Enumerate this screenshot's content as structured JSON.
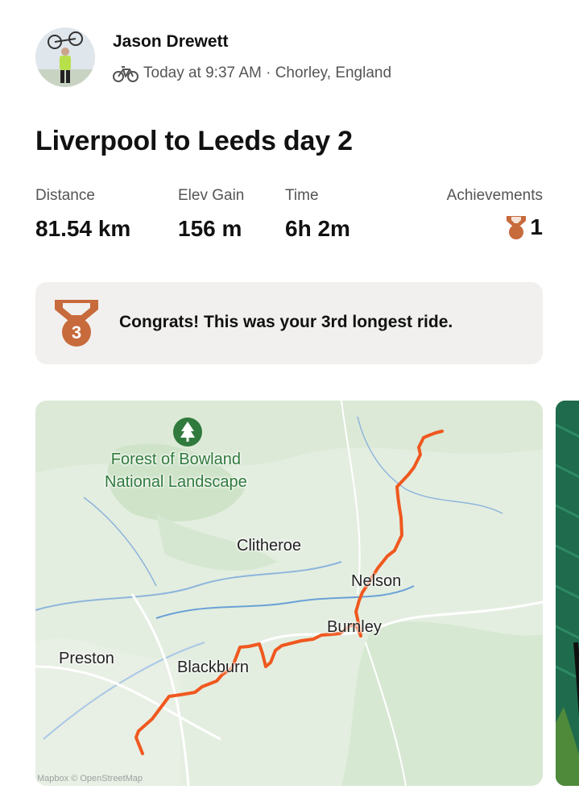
{
  "athlete": {
    "name": "Jason Drewett",
    "meta": "Today at 9:37 AM · Chorley, England",
    "activity_icon": "bike-icon"
  },
  "activity": {
    "title": "Liverpool to Leeds day 2"
  },
  "stats": {
    "distance": {
      "label": "Distance",
      "value": "81.54 km"
    },
    "elev_gain": {
      "label": "Elev Gain",
      "value": "156 m"
    },
    "time": {
      "label": "Time",
      "value": "6h 2m"
    },
    "achievements": {
      "label": "Achievements",
      "value": "1",
      "icon": "medal-icon"
    }
  },
  "banner": {
    "rank": "3",
    "text": "Congrats! This was your 3rd longest ride.",
    "icon": "bronze-medal-icon"
  },
  "map": {
    "labels": {
      "park": "Forest of Bowland\nNational Landscape",
      "park_line1": "Forest of Bowland",
      "park_line2": "National Landscape",
      "clitheroe": "Clitheroe",
      "nelson": "Nelson",
      "burnley": "Burnley",
      "preston": "Preston",
      "blackburn": "Blackburn"
    },
    "attribution": "Mapbox © OpenStreetMap",
    "route_color": "#f0581f"
  },
  "colors": {
    "medal_bronze": "#c76a3c",
    "banner_bg": "#f1f0ee",
    "park_green": "#2f7a3c"
  }
}
